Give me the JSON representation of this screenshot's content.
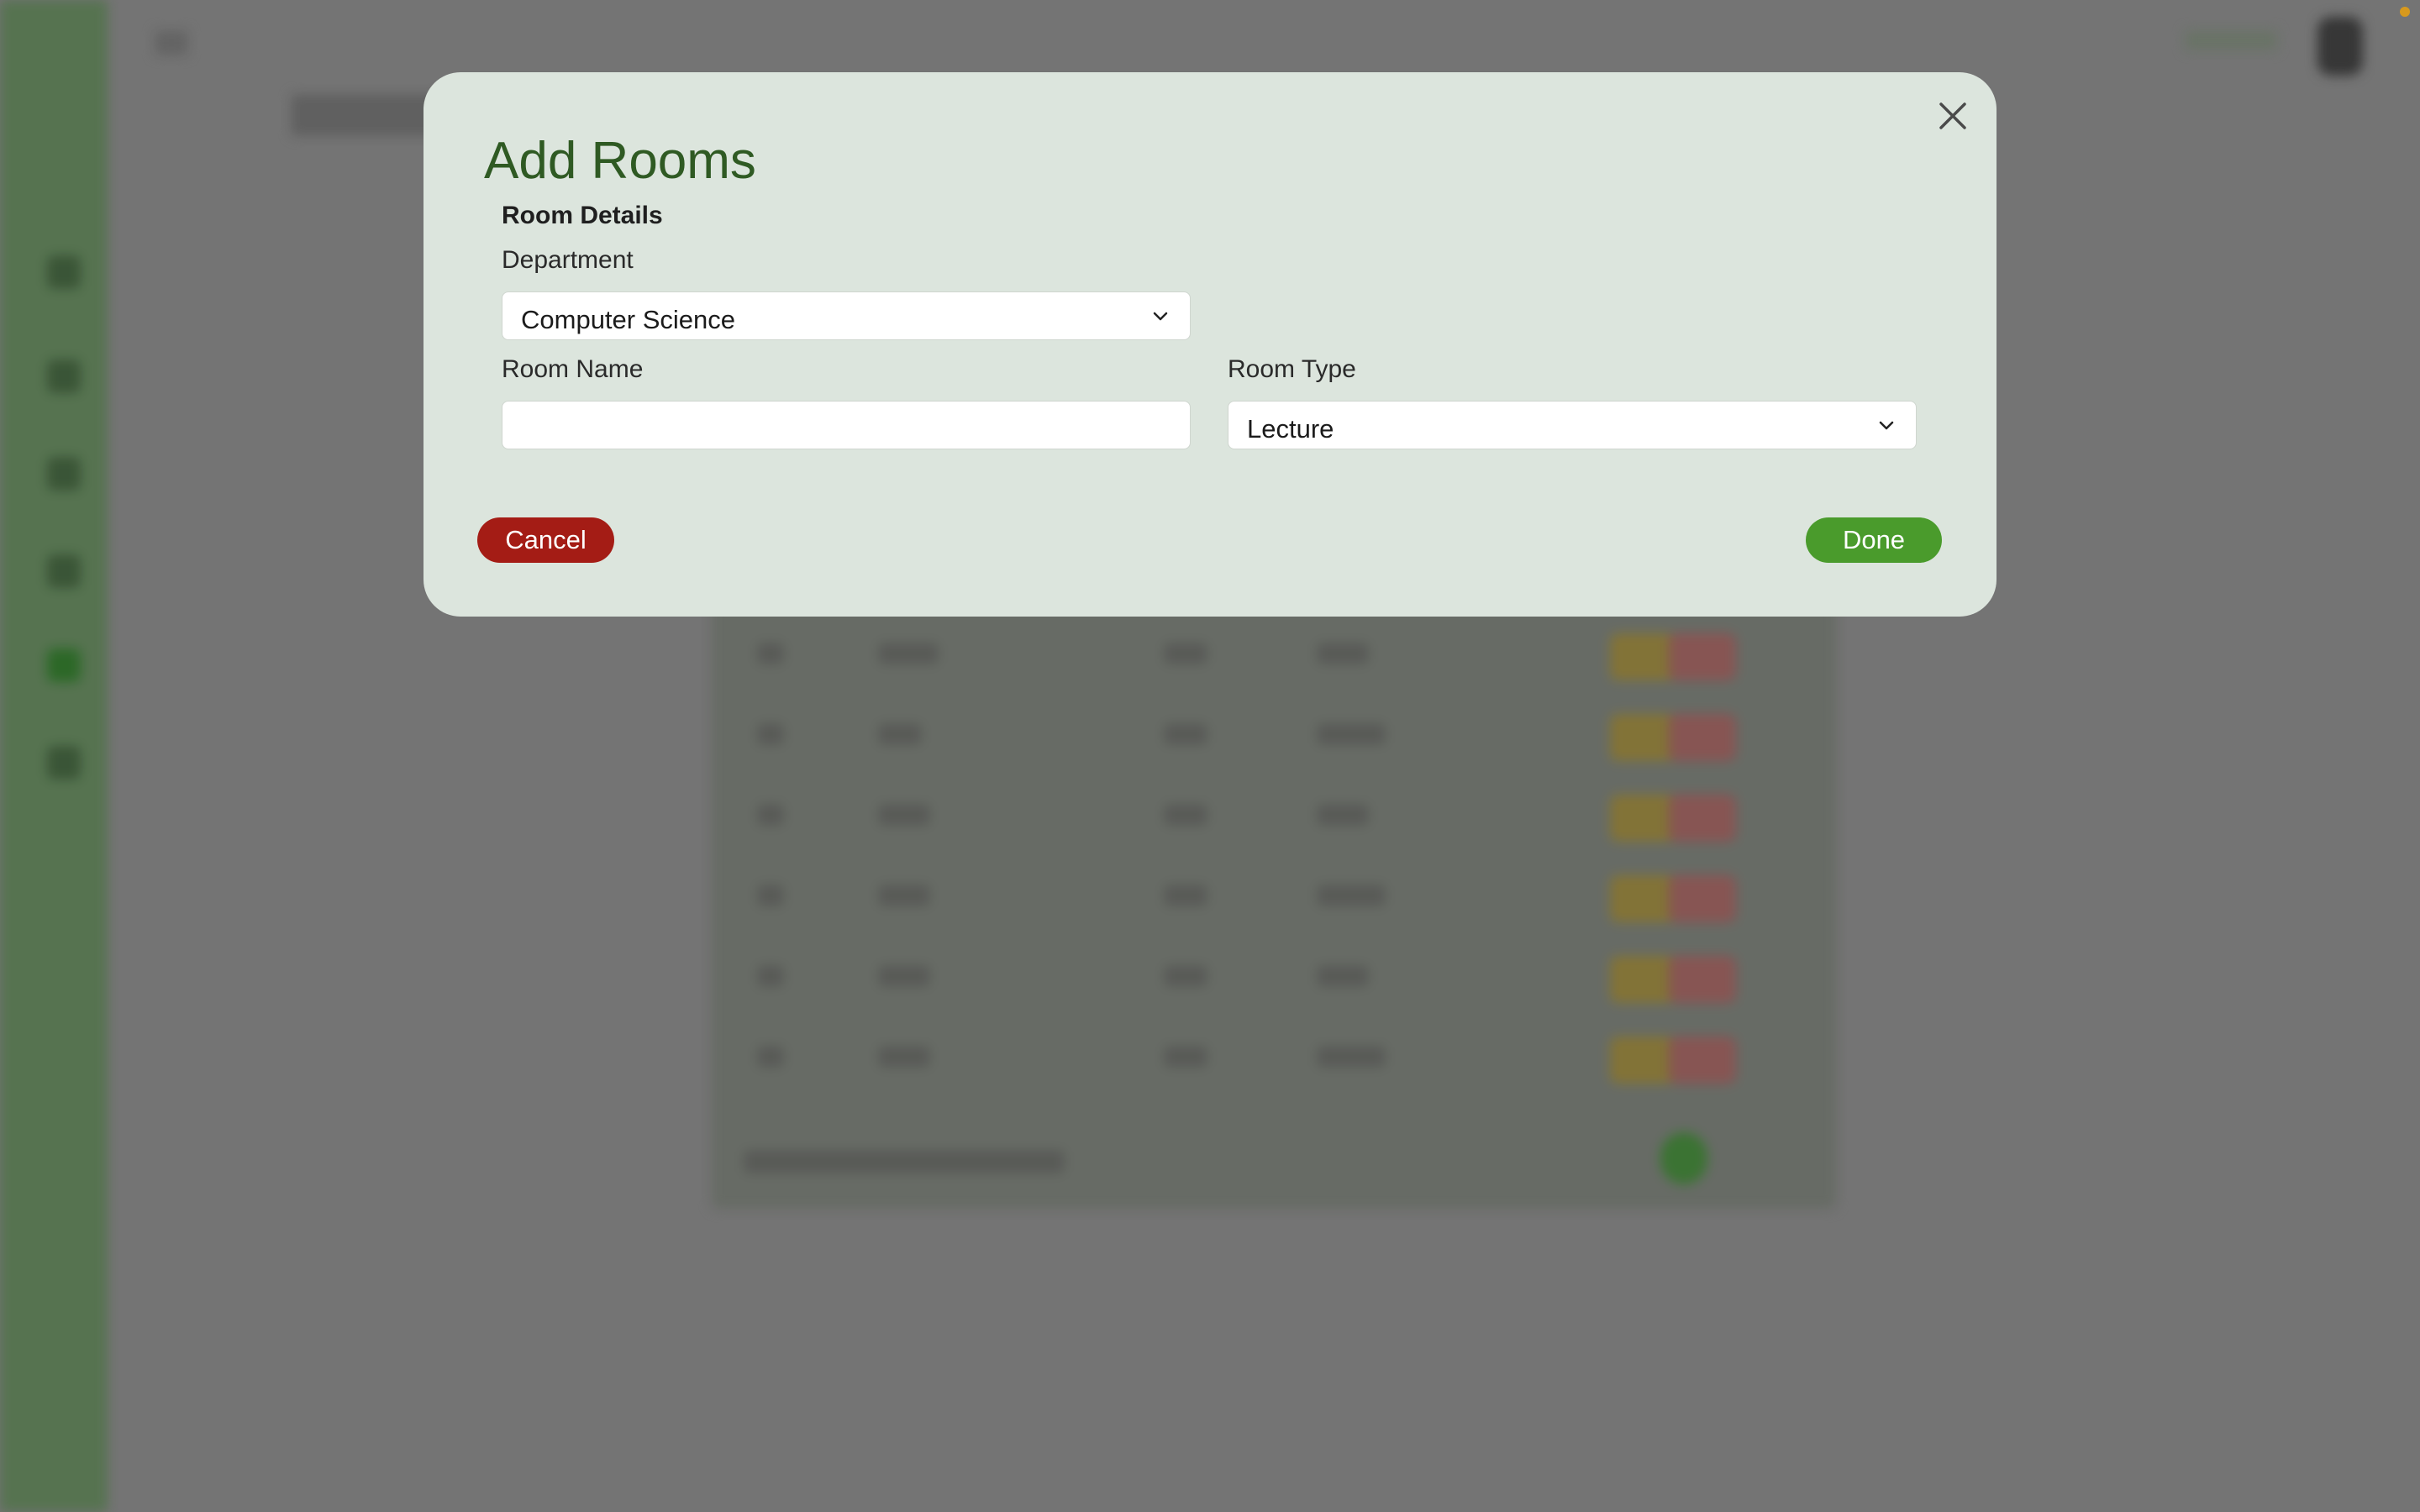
{
  "modal": {
    "title": "Add Rooms",
    "section_title": "Room Details",
    "department": {
      "label": "Department",
      "value": "Computer Science"
    },
    "room_name": {
      "label": "Room Name",
      "value": "",
      "placeholder": ""
    },
    "room_type": {
      "label": "Room Type",
      "value": "Lecture"
    },
    "cancel_label": "Cancel",
    "done_label": "Done",
    "icons": {
      "close": "close-icon",
      "dropdown": "chevron-down-icon"
    }
  },
  "colors": {
    "modal_background": "#dce5dd",
    "title_green": "#2f5a23",
    "cancel_red": "#a41c15",
    "done_green": "#4a9b2c",
    "sidebar_green": "#5b7a55",
    "overlay_gray": "#7b7b7b"
  }
}
